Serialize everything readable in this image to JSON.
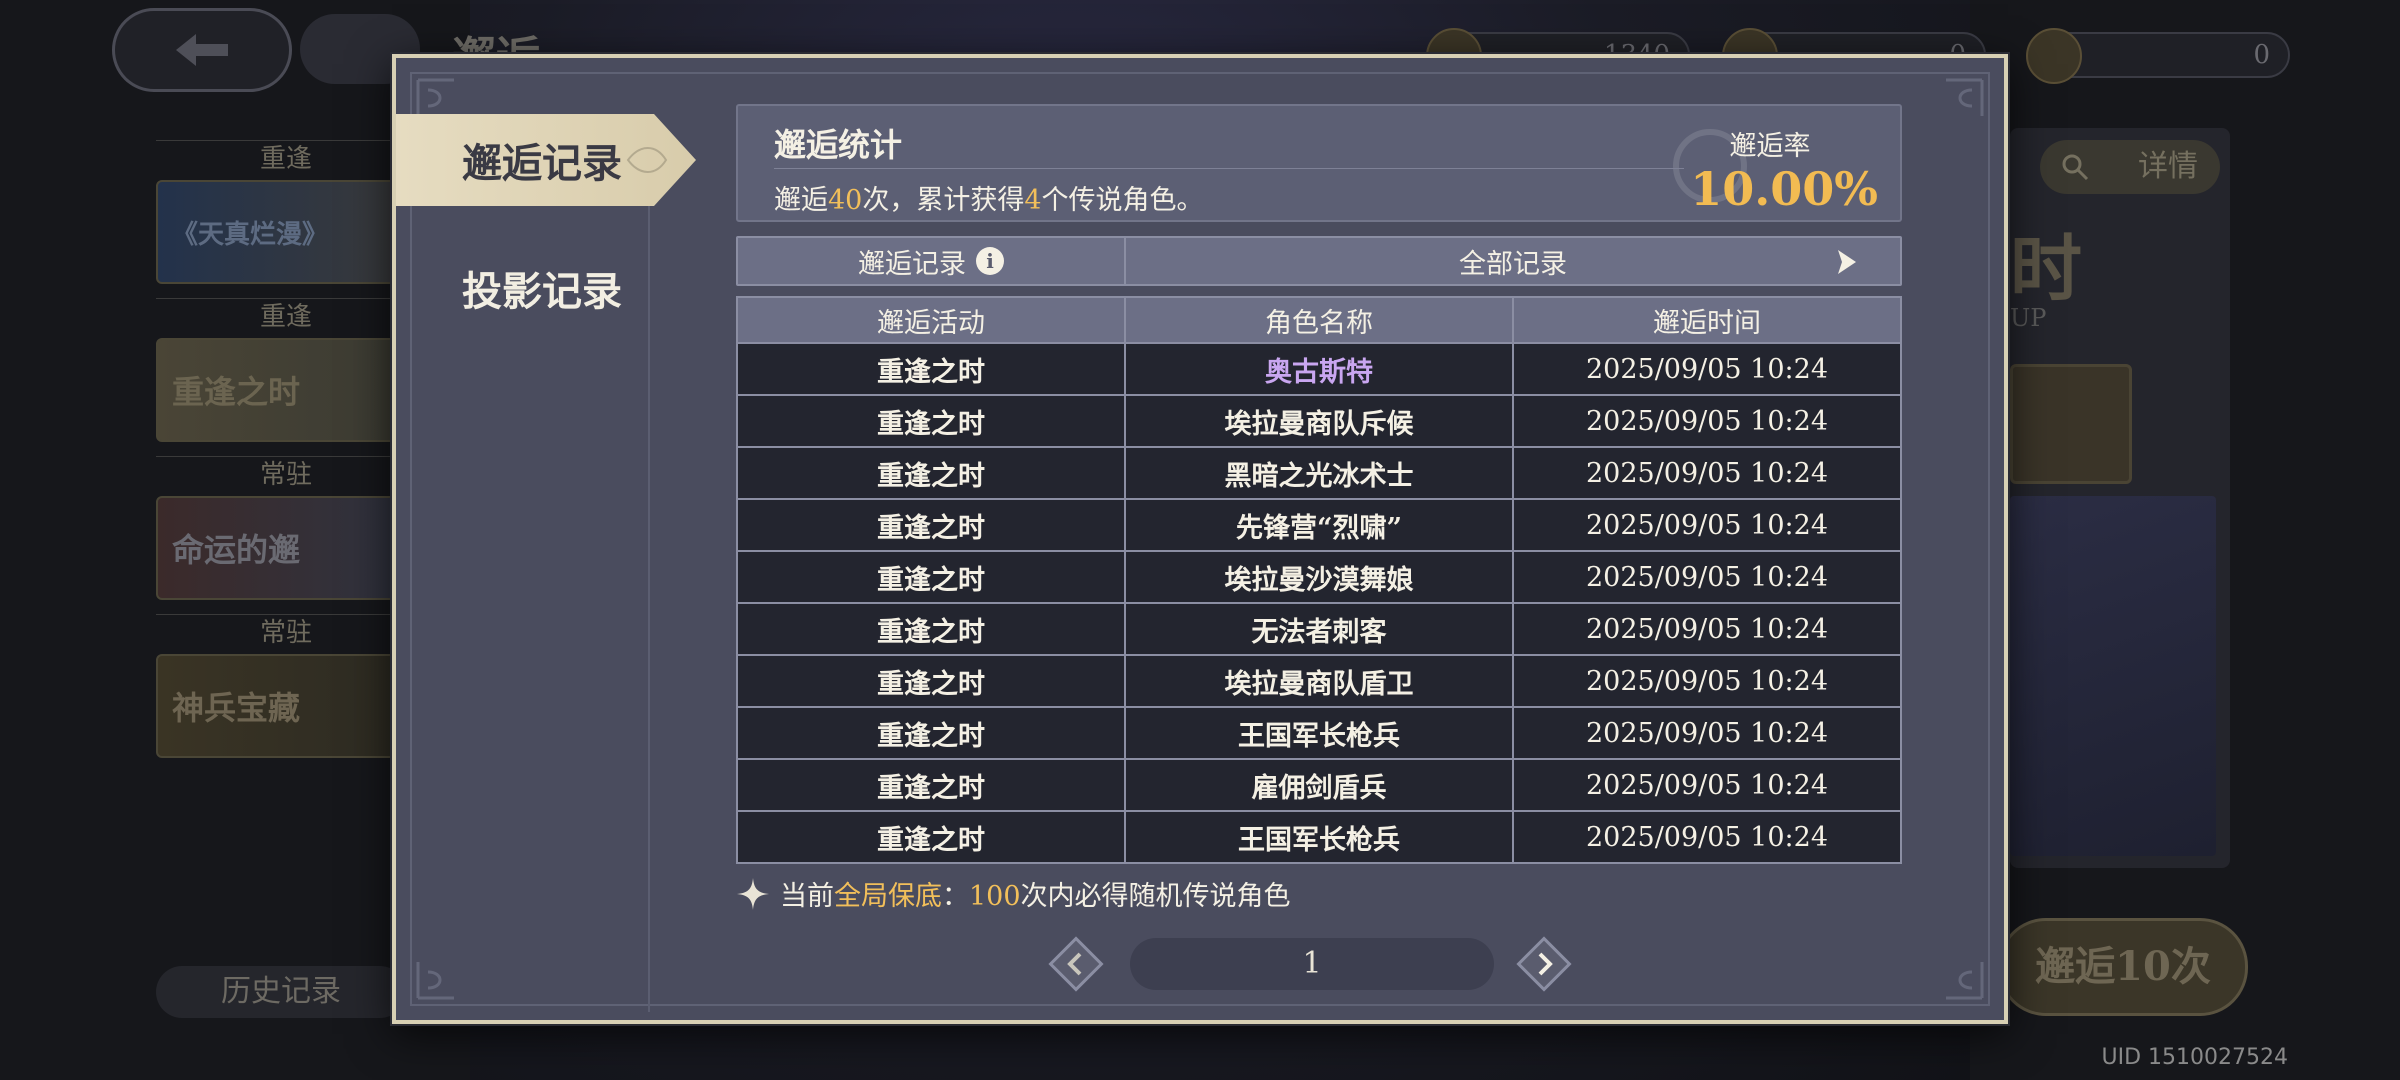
{
  "background": {
    "title": "邂逅",
    "currencies": [
      "1340",
      "0",
      "0"
    ],
    "left_tabs": [
      {
        "group": "重逢",
        "banner": "《天真烂漫》"
      },
      {
        "group": "重逢",
        "banner": "重逢之时"
      },
      {
        "group": "常驻",
        "banner": "命运的邂"
      },
      {
        "group": "常驻",
        "banner": "神兵宝藏"
      }
    ],
    "history_button": "历史记录",
    "detail_button": "详情",
    "right_big_char": "时",
    "right_up": "UP",
    "pull10_button": "邂逅10次",
    "uid": "UID 1510027524"
  },
  "modal": {
    "tabs": [
      {
        "label": "邂逅记录",
        "active": true
      },
      {
        "label": "投影记录",
        "active": false
      }
    ],
    "stats": {
      "title": "邂逅统计",
      "text_prefix": "邂逅",
      "pulls": "40",
      "text_mid": "次，累计获得",
      "legendary_count": "4",
      "text_suffix": "个传说角色。",
      "rate_label": "邂逅率",
      "rate_value": "10.00%"
    },
    "filter": {
      "left_label": "邂逅记录",
      "info_glyph": "i",
      "right_label": "全部记录"
    },
    "table": {
      "headers": [
        "邂逅活动",
        "角色名称",
        "邂逅时间"
      ],
      "rows": [
        {
          "activity": "重逢之时",
          "character": "奥古斯特",
          "time": "2025/09/05 10:24",
          "legendary": true
        },
        {
          "activity": "重逢之时",
          "character": "埃拉曼商队斥候",
          "time": "2025/09/05 10:24",
          "legendary": false
        },
        {
          "activity": "重逢之时",
          "character": "黑暗之光冰术士",
          "time": "2025/09/05 10:24",
          "legendary": false
        },
        {
          "activity": "重逢之时",
          "character": "先锋营“烈啸”",
          "time": "2025/09/05 10:24",
          "legendary": false
        },
        {
          "activity": "重逢之时",
          "character": "埃拉曼沙漠舞娘",
          "time": "2025/09/05 10:24",
          "legendary": false
        },
        {
          "activity": "重逢之时",
          "character": "无法者刺客",
          "time": "2025/09/05 10:24",
          "legendary": false
        },
        {
          "activity": "重逢之时",
          "character": "埃拉曼商队盾卫",
          "time": "2025/09/05 10:24",
          "legendary": false
        },
        {
          "activity": "重逢之时",
          "character": "王国军长枪兵",
          "time": "2025/09/05 10:24",
          "legendary": false
        },
        {
          "activity": "重逢之时",
          "character": "雇佣剑盾兵",
          "time": "2025/09/05 10:24",
          "legendary": false
        },
        {
          "activity": "重逢之时",
          "character": "王国军长枪兵",
          "time": "2025/09/05 10:24",
          "legendary": false
        }
      ]
    },
    "pity": {
      "prefix": "当前",
      "type": "全局保底",
      "colon": "：",
      "count": "100",
      "suffix": "次内必得随机传说角色"
    },
    "pager": {
      "page": "1"
    },
    "colors": {
      "accent_gold": "#f2bf5a",
      "legendary_purple": "#c9a6f0",
      "panel": "#4a4c5e",
      "frame": "#d8d0b4"
    }
  }
}
